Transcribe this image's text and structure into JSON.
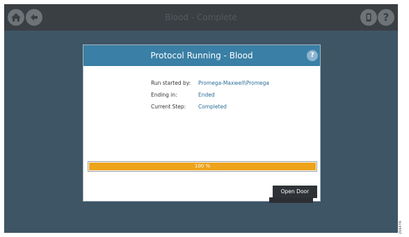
{
  "window": {
    "title": "Blood - Complete"
  },
  "topbar": {
    "icons": [
      "home-icon",
      "back-arrow-icon",
      "door-icon",
      "help-icon"
    ],
    "help_glyph": "?"
  },
  "dialog": {
    "title": "Protocol Running - Blood",
    "help_glyph": "?",
    "info": {
      "started_label": "Run started by:",
      "started_value": "Promega-Maxwell\\Promega",
      "ending_label": "Ending in:",
      "ending_value": "Ended",
      "step_label": "Current Step:",
      "step_value": "Completed"
    },
    "progress": {
      "percent": 100,
      "label": "100 %"
    },
    "open_door_label": "Open Door"
  },
  "figure_id": "26647A",
  "colors": {
    "background": "#3e5566",
    "topbar": "#3a3f44",
    "dialog_header": "#3a7fa5",
    "progress": "#eda31a",
    "value_text": "#2a6d96",
    "button": "#2f3337"
  }
}
